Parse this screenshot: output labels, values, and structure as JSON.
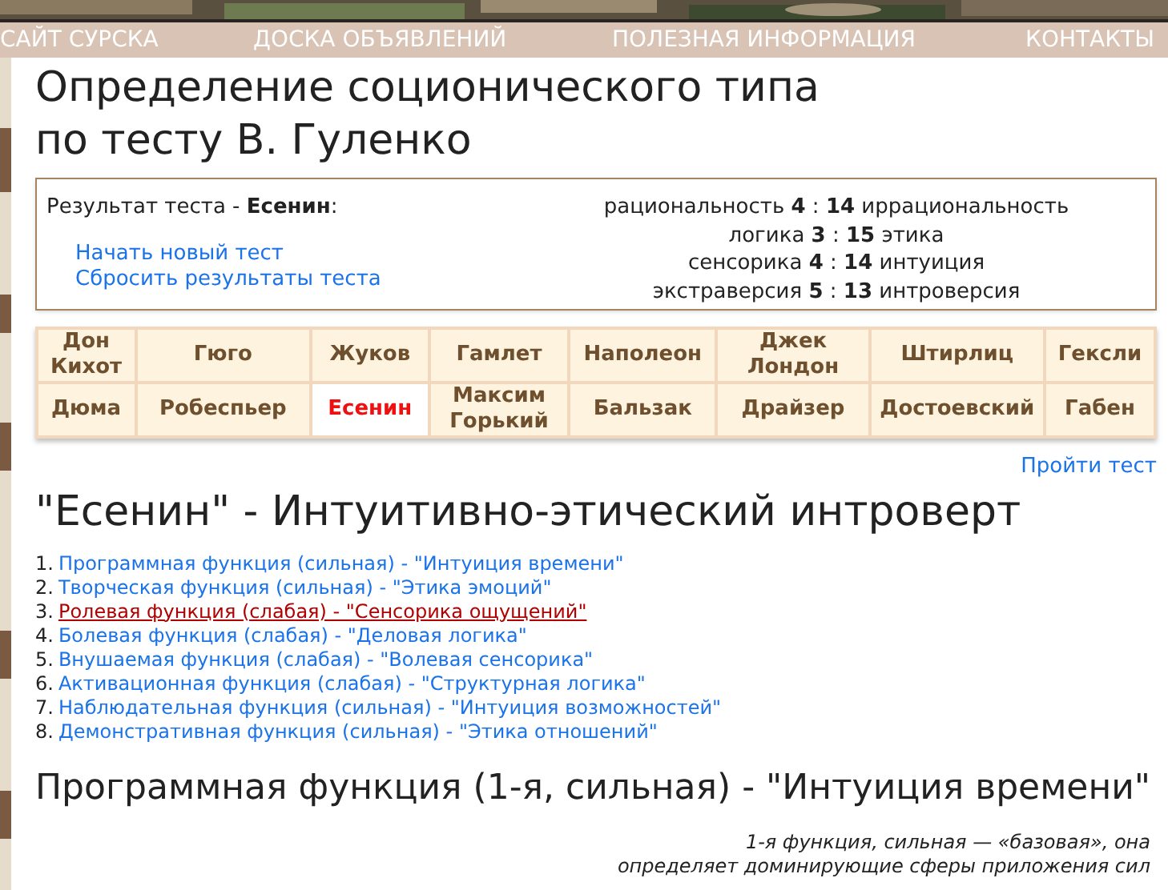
{
  "nav": [
    {
      "label": "САЙТ СУРСКА"
    },
    {
      "label": "ДОСКА ОБЪЯВЛЕНИЙ"
    },
    {
      "label": "ПОЛЕЗНАЯ ИНФОРМАЦИЯ"
    },
    {
      "label": "КОНТАКТЫ"
    }
  ],
  "title": [
    "Определение соционического типа",
    "по тесту В. Гуленко"
  ],
  "result": {
    "label": "Результат теста - **Есенин**:",
    "links": [
      "Начать новый тест",
      "Сбросить результаты теста"
    ],
    "scores": [
      "рациональность **4** : **14** иррациональность",
      "логика **3** : **15** этика",
      "сенсорика **4** : **14** интуиция",
      "экстраверсия **5** : **13** интроверсия"
    ]
  },
  "types": [
    [
      {
        "name": "Дон Кихот",
        "selected": false
      },
      {
        "name": "Гюго",
        "selected": false
      },
      {
        "name": "Жуков",
        "selected": false
      },
      {
        "name": "Гамлет",
        "selected": false
      },
      {
        "name": "Наполеон",
        "selected": false
      },
      {
        "name": "Джек Лондон",
        "selected": false
      },
      {
        "name": "Штирлиц",
        "selected": false
      },
      {
        "name": "Гексли",
        "selected": false
      }
    ],
    [
      {
        "name": "Дюма",
        "selected": false
      },
      {
        "name": "Робеспьер",
        "selected": false
      },
      {
        "name": "Есенин",
        "selected": true
      },
      {
        "name": "Максим Горький",
        "selected": false
      },
      {
        "name": "Бальзак",
        "selected": false
      },
      {
        "name": "Драйзер",
        "selected": false
      },
      {
        "name": "Достоевский",
        "selected": false
      },
      {
        "name": "Габен",
        "selected": false
      }
    ]
  ],
  "take_test_link": "Пройти тест",
  "type_heading": "\"Есенин\" - Интуитивно-этический интроверт",
  "functions": [
    {
      "number": "1.",
      "label": "Программная функция (сильная) - \"Интуиция времени\"",
      "selected": false
    },
    {
      "number": "2.",
      "label": "Творческая функция (сильная) - \"Этика эмоций\"",
      "selected": false
    },
    {
      "number": "3.",
      "label": "Ролевая функция (слабая) - \"Сенсорика ощущений\"",
      "selected": true
    },
    {
      "number": "4.",
      "label": "Болевая функция (слабая) - \"Деловая логика\"",
      "selected": false
    },
    {
      "number": "5.",
      "label": "Внушаемая функция (слабая) - \"Волевая сенсорика\"",
      "selected": false
    },
    {
      "number": "6.",
      "label": "Активационная функция (слабая) - \"Структурная логика\"",
      "selected": false
    },
    {
      "number": "7.",
      "label": "Наблюдательная функция (сильная) - \"Интуиция возможностей\"",
      "selected": false
    },
    {
      "number": "8.",
      "label": "Демонстративная функция (сильная) - \"Этика отношений\"",
      "selected": false
    }
  ],
  "section_heading": "Программная функция (1-я, сильная) - \"Интуиция времени\"",
  "description": [
    "1-я функция, сильная — «базовая», она",
    "определяет доминирующие сферы приложения сил"
  ]
}
